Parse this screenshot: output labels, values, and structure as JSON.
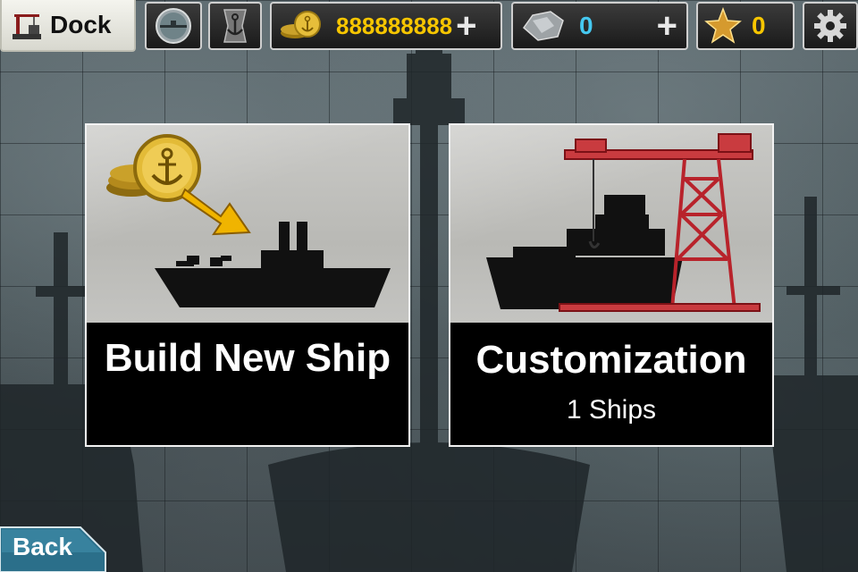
{
  "topbar": {
    "dock_label": "Dock",
    "coins": "888888888",
    "ore": "0",
    "stars": "0"
  },
  "cards": [
    {
      "title": "Build New Ship",
      "subtitle": ""
    },
    {
      "title": "Customization",
      "subtitle": "1 Ships"
    }
  ],
  "back_label": "Back",
  "colors": {
    "coin_text": "#f7c600",
    "ore_text": "#45c8f0",
    "crane_red": "#b8232b"
  },
  "icons": [
    "dock-crane-icon",
    "periscope-icon",
    "anchor-emblem-icon",
    "coin-icon",
    "add-icon",
    "ore-icon",
    "star-icon",
    "gear-icon",
    "coin-stack-icon",
    "arrow-icon",
    "warship-silhouette",
    "crane-icon"
  ]
}
